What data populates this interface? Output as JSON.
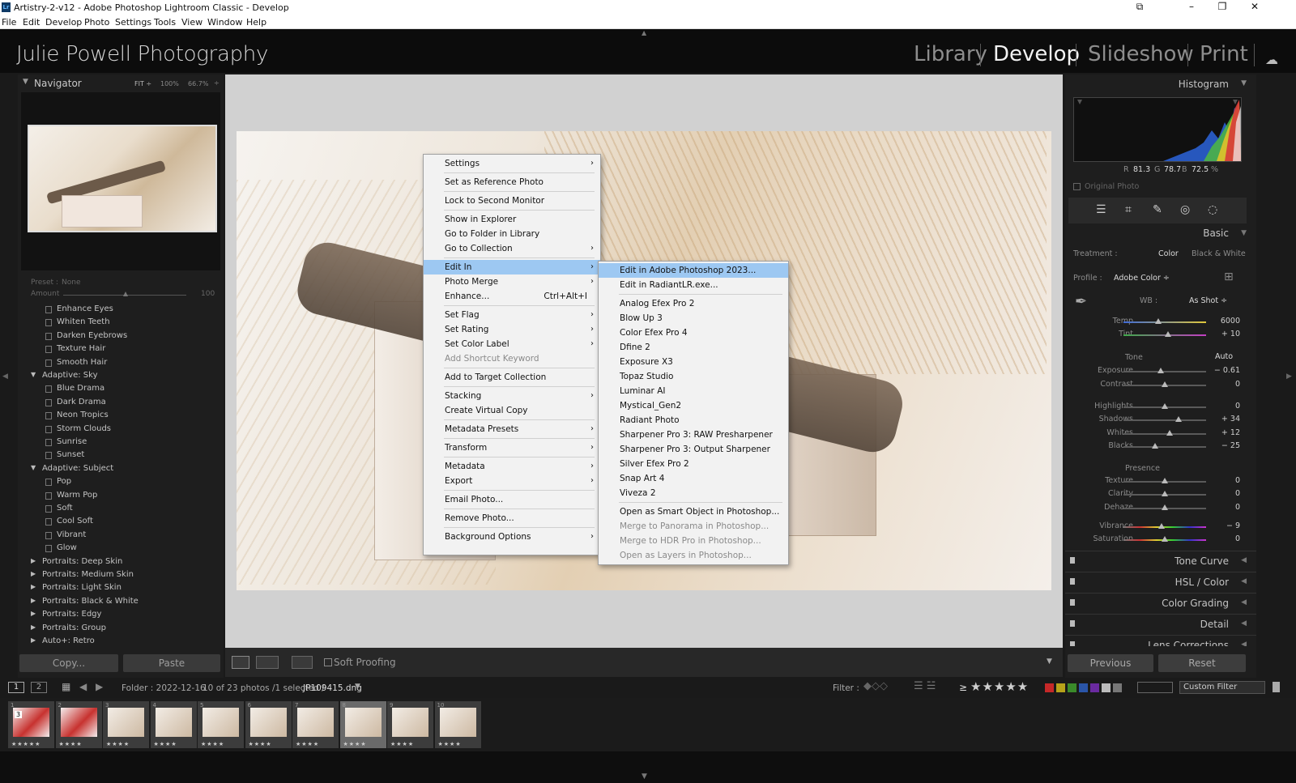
{
  "window": {
    "app_icon": "Lr",
    "title": "Artistry-2-v12 - Adobe Photoshop Lightroom Classic - Develop",
    "controls": [
      "minimize-icon",
      "maximize-icon",
      "close-icon"
    ]
  },
  "menubar": [
    "File",
    "Edit",
    "Develop",
    "Photo",
    "Settings",
    "Tools",
    "View",
    "Window",
    "Help"
  ],
  "identity_plate": "Julie Powell Photography",
  "modules": [
    {
      "label": "Library",
      "active": false
    },
    {
      "label": "Develop",
      "active": true
    },
    {
      "label": "Slideshow",
      "active": false
    },
    {
      "label": "Print",
      "active": false
    }
  ],
  "navigator": {
    "title": "Navigator",
    "zoom_options": [
      "FIT ÷",
      "100%",
      "66.7%"
    ]
  },
  "presets_panel": {
    "preset_label": "Preset :",
    "preset_value": "None",
    "amount_label": "Amount",
    "amount_value": "100",
    "rows": [
      {
        "type": "item",
        "label": "Enhance Eyes"
      },
      {
        "type": "item",
        "label": "Whiten Teeth"
      },
      {
        "type": "item",
        "label": "Darken Eyebrows"
      },
      {
        "type": "item",
        "label": "Texture Hair"
      },
      {
        "type": "item",
        "label": "Smooth Hair"
      },
      {
        "type": "group-open",
        "label": "Adaptive: Sky"
      },
      {
        "type": "item",
        "label": "Blue Drama"
      },
      {
        "type": "item",
        "label": "Dark Drama"
      },
      {
        "type": "item",
        "label": "Neon Tropics"
      },
      {
        "type": "item",
        "label": "Storm Clouds"
      },
      {
        "type": "item",
        "label": "Sunrise"
      },
      {
        "type": "item",
        "label": "Sunset"
      },
      {
        "type": "group-open",
        "label": "Adaptive: Subject"
      },
      {
        "type": "item",
        "label": "Pop"
      },
      {
        "type": "item",
        "label": "Warm Pop"
      },
      {
        "type": "item",
        "label": "Soft"
      },
      {
        "type": "item",
        "label": "Cool Soft"
      },
      {
        "type": "item",
        "label": "Vibrant"
      },
      {
        "type": "item",
        "label": "Glow"
      },
      {
        "type": "group-closed",
        "label": "Portraits: Deep Skin"
      },
      {
        "type": "group-closed",
        "label": "Portraits: Medium Skin"
      },
      {
        "type": "group-closed",
        "label": "Portraits: Light Skin"
      },
      {
        "type": "group-closed",
        "label": "Portraits: Black & White"
      },
      {
        "type": "group-closed",
        "label": "Portraits: Edgy"
      },
      {
        "type": "group-closed",
        "label": "Portraits: Group"
      },
      {
        "type": "group-closed",
        "label": "Auto+: Retro"
      }
    ],
    "copy_label": "Copy...",
    "paste_label": "Paste"
  },
  "toolbar": {
    "soft_proofing_label": "Soft Proofing"
  },
  "context_menu": {
    "items": [
      {
        "label": "Settings",
        "submenu": true
      },
      {
        "sep": true
      },
      {
        "label": "Set as Reference Photo"
      },
      {
        "sep": true
      },
      {
        "label": "Lock to Second Monitor"
      },
      {
        "sep": true
      },
      {
        "label": "Show in Explorer"
      },
      {
        "label": "Go to Folder in Library"
      },
      {
        "label": "Go to Collection",
        "submenu": true
      },
      {
        "sep": true
      },
      {
        "label": "Edit In",
        "submenu": true,
        "highlight": true
      },
      {
        "label": "Photo Merge",
        "submenu": true
      },
      {
        "label": "Enhance...",
        "shortcut": "Ctrl+Alt+I"
      },
      {
        "sep": true
      },
      {
        "label": "Set Flag",
        "submenu": true
      },
      {
        "label": "Set Rating",
        "submenu": true
      },
      {
        "label": "Set Color Label",
        "submenu": true
      },
      {
        "label": "Add Shortcut Keyword",
        "disabled": true
      },
      {
        "sep": true
      },
      {
        "label": "Add to Target Collection"
      },
      {
        "sep": true
      },
      {
        "label": "Stacking",
        "submenu": true
      },
      {
        "label": "Create Virtual Copy"
      },
      {
        "sep": true
      },
      {
        "label": "Metadata Presets",
        "submenu": true
      },
      {
        "sep": true
      },
      {
        "label": "Transform",
        "submenu": true
      },
      {
        "sep": true
      },
      {
        "label": "Metadata",
        "submenu": true
      },
      {
        "label": "Export",
        "submenu": true
      },
      {
        "sep": true
      },
      {
        "label": "Email Photo..."
      },
      {
        "sep": true
      },
      {
        "label": "Remove Photo..."
      },
      {
        "sep": true
      },
      {
        "label": "Background Options",
        "submenu": true
      }
    ]
  },
  "edit_in_submenu": {
    "items": [
      {
        "label": "Edit in Adobe Photoshop 2023...",
        "highlight": true
      },
      {
        "label": "Edit in RadiantLR.exe..."
      },
      {
        "sep": true
      },
      {
        "label": "Analog Efex Pro 2"
      },
      {
        "label": "Blow Up 3"
      },
      {
        "label": "Color Efex Pro 4"
      },
      {
        "label": "Dfine 2"
      },
      {
        "label": "Exposure X3"
      },
      {
        "label": "Topaz Studio"
      },
      {
        "label": "Luminar AI"
      },
      {
        "label": "Mystical_Gen2"
      },
      {
        "label": "Radiant Photo"
      },
      {
        "label": "Sharpener Pro 3: RAW Presharpener"
      },
      {
        "label": "Sharpener Pro 3: Output Sharpener"
      },
      {
        "label": "Silver Efex Pro 2"
      },
      {
        "label": "Snap Art 4"
      },
      {
        "label": "Viveza 2"
      },
      {
        "sep": true
      },
      {
        "label": "Open as Smart Object in Photoshop..."
      },
      {
        "label": "Merge to Panorama in Photoshop...",
        "disabled": true
      },
      {
        "label": "Merge to HDR Pro in Photoshop...",
        "disabled": true
      },
      {
        "label": "Open as Layers in Photoshop...",
        "disabled": true
      }
    ]
  },
  "histogram": {
    "title": "Histogram",
    "r_label": "R",
    "r_value": "81.3",
    "g_label": "G",
    "g_value": "78.7",
    "b_label": "B",
    "b_value": "72.5",
    "unit": "%",
    "original_photo_label": "Original Photo"
  },
  "basic": {
    "title": "Basic",
    "treatment_label": "Treatment :",
    "treatment_color": "Color",
    "treatment_bw": "Black & White",
    "profile_label": "Profile :",
    "profile_value": "Adobe Color ÷",
    "wb_label": "WB :",
    "wb_value": "As Shot ÷",
    "tone_label": "Tone",
    "auto_label": "Auto",
    "presence_label": "Presence",
    "sliders": [
      {
        "label": "Temp",
        "value": "6000",
        "pos": 0.42,
        "kind": "temp"
      },
      {
        "label": "Tint",
        "value": "+ 10",
        "pos": 0.54,
        "kind": "tint"
      },
      {
        "label": "Exposure",
        "value": "− 0.61",
        "pos": 0.45,
        "kind": "gray"
      },
      {
        "label": "Contrast",
        "value": "0",
        "pos": 0.5,
        "kind": "gray"
      },
      {
        "label": "Highlights",
        "value": "0",
        "pos": 0.5,
        "kind": "gray"
      },
      {
        "label": "Shadows",
        "value": "+ 34",
        "pos": 0.67,
        "kind": "gray"
      },
      {
        "label": "Whites",
        "value": "+ 12",
        "pos": 0.56,
        "kind": "gray"
      },
      {
        "label": "Blacks",
        "value": "− 25",
        "pos": 0.38,
        "kind": "gray"
      },
      {
        "label": "Texture",
        "value": "0",
        "pos": 0.5,
        "kind": "gray"
      },
      {
        "label": "Clarity",
        "value": "0",
        "pos": 0.5,
        "kind": "gray"
      },
      {
        "label": "Dehaze",
        "value": "0",
        "pos": 0.5,
        "kind": "gray"
      },
      {
        "label": "Vibrance",
        "value": "− 9",
        "pos": 0.46,
        "kind": "color"
      },
      {
        "label": "Saturation",
        "value": "0",
        "pos": 0.5,
        "kind": "color"
      }
    ]
  },
  "right_sections": [
    "Tone Curve",
    "HSL / Color",
    "Color Grading",
    "Detail",
    "Lens Corrections"
  ],
  "previous_label": "Previous",
  "reset_label": "Reset",
  "filmstrip_bar": {
    "view1": "1",
    "view2": "2",
    "folder": "Folder : 2022-12-16",
    "count": "10 of 23 photos /1 selected /",
    "filename": "JP109415.dng",
    "filter_label": "Filter :",
    "rating_op": "≥",
    "stars": "★★★★★",
    "custom_filter": "Custom Filter",
    "label_colors": [
      "#c62828",
      "#b7a21a",
      "#3a8a2a",
      "#2a55a8",
      "#6a2aa0",
      "#bbbbbb",
      "#777777"
    ]
  },
  "filmstrip": {
    "thumbs": [
      {
        "num": "1",
        "stars": "★★★★★",
        "badge": "3"
      },
      {
        "num": "2",
        "stars": "★★★★"
      },
      {
        "num": "3",
        "stars": "★★★★"
      },
      {
        "num": "4",
        "stars": "★★★★"
      },
      {
        "num": "5",
        "stars": "★★★★"
      },
      {
        "num": "6",
        "stars": "★★★★"
      },
      {
        "num": "7",
        "stars": "★★★★"
      },
      {
        "num": "8",
        "stars": "★★★★",
        "selected": true
      },
      {
        "num": "9",
        "stars": "★★★★"
      },
      {
        "num": "10",
        "stars": "★★★★"
      }
    ]
  },
  "colors": {
    "menu_highlight": "#9dc8f2",
    "panel_bg": "#1e1e1e",
    "center_bg": "#d1d1d1"
  }
}
